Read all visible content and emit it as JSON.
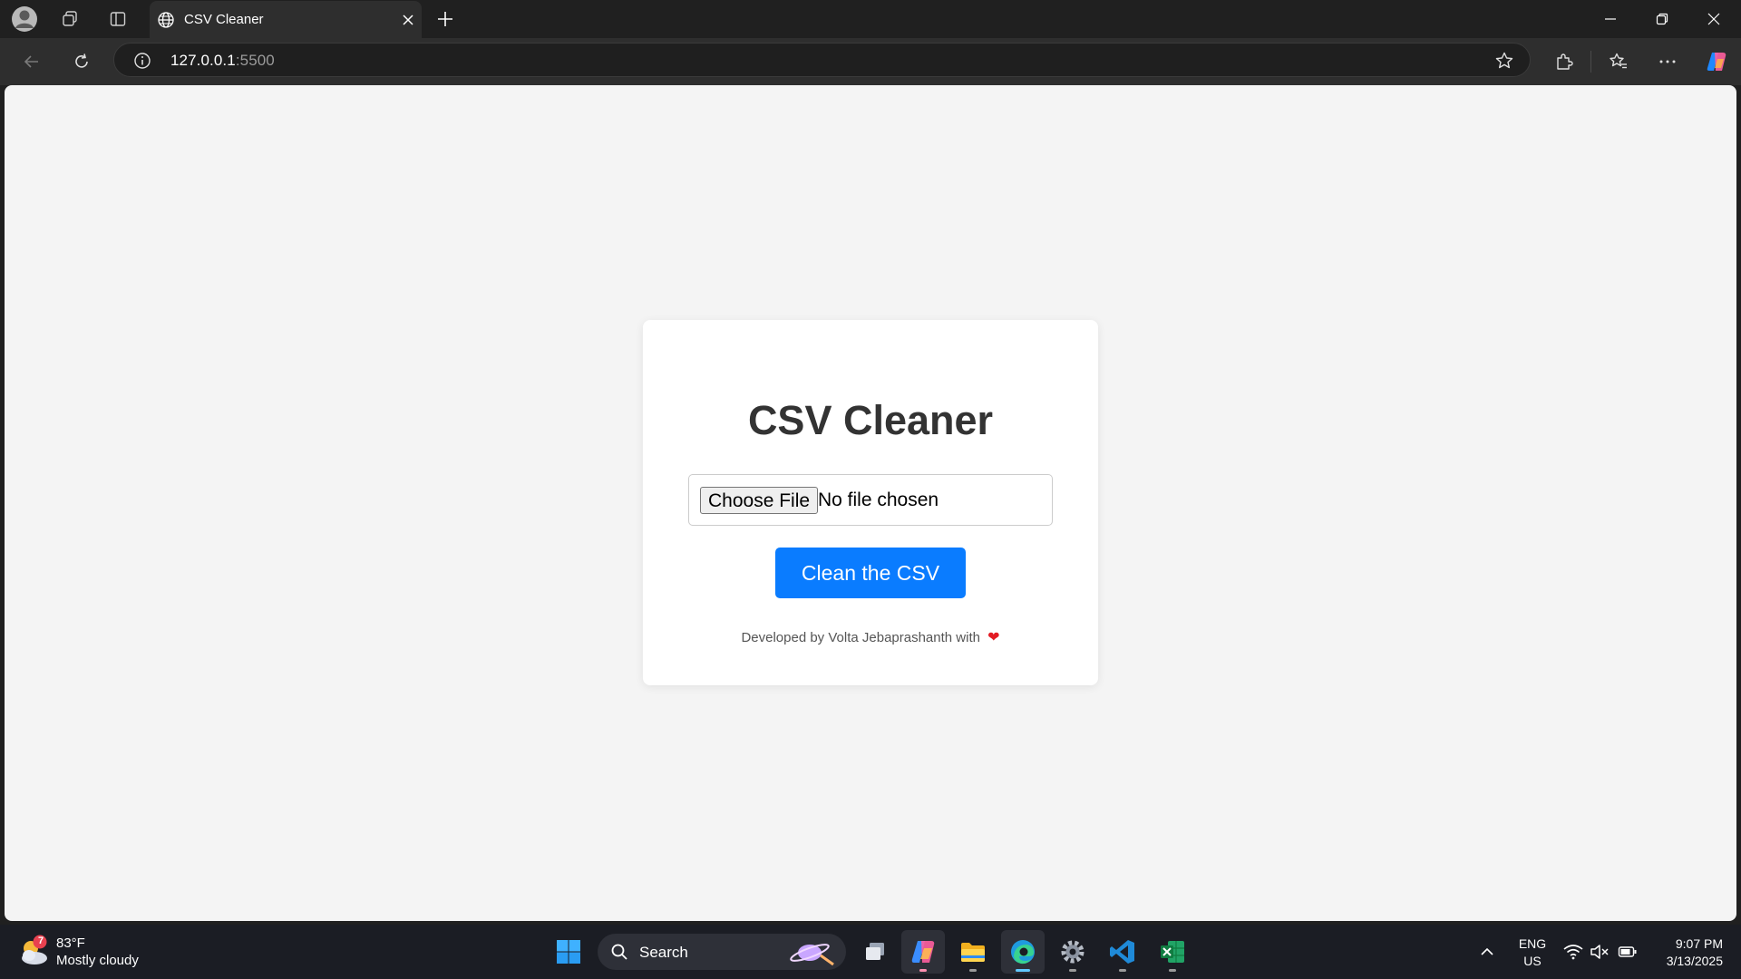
{
  "browser": {
    "tab_title": "CSV Cleaner",
    "url_host": "127.0.0.1",
    "url_port": ":5500"
  },
  "page": {
    "title": "CSV Cleaner",
    "choose_file_label": "Choose File",
    "file_status": "No file chosen",
    "clean_button_label": "Clean the CSV",
    "footer_text": "Developed by Volta Jebaprashanth with",
    "footer_icon": "heart-icon",
    "accent_color": "#0a7cff"
  },
  "taskbar": {
    "weather_badge": "7",
    "weather_temp": "83°F",
    "weather_desc": "Mostly cloudy",
    "search_label": "Search",
    "lang_primary": "ENG",
    "lang_secondary": "US",
    "time": "9:07 PM",
    "date": "3/13/2025"
  }
}
